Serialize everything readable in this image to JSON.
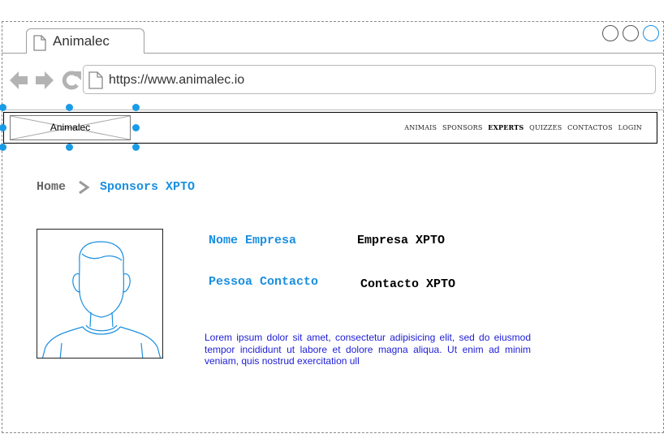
{
  "browser": {
    "tab_title": "Animalec",
    "url": "https://www.animalec.io"
  },
  "site": {
    "logo_label": "Animalec",
    "menu": [
      {
        "label": "ANIMAIS",
        "active": false
      },
      {
        "label": "SPONSORS",
        "active": false
      },
      {
        "label": "EXPERTS",
        "active": true
      },
      {
        "label": "QUIZZES",
        "active": false
      },
      {
        "label": "CONTACTOS",
        "active": false
      },
      {
        "label": "LOGIN",
        "active": false
      }
    ]
  },
  "breadcrumb": {
    "home": "Home",
    "current": "Sponsors XPTO"
  },
  "sponsor": {
    "company_label": "Nome Empresa",
    "company_value": "Empresa XPTO",
    "contact_label": "Pessoa Contacto",
    "contact_value": "Contacto XPTO",
    "description": "Lorem ipsum dolor sit amet, consectetur adipisicing elit, sed do eiusmod tempor incididunt ut labore et dolore magna aliqua. Ut enim ad minim veniam, quis nostrud exercitation ull"
  },
  "icons": {
    "tab": "page-icon",
    "back": "back-arrow-icon",
    "forward": "forward-arrow-icon",
    "reload": "reload-icon",
    "url": "page-icon",
    "photo": "person-placeholder-icon"
  },
  "colors": {
    "accent": "#1a8fe0",
    "selection": "#1a9be6",
    "description_text": "#2020d8"
  }
}
